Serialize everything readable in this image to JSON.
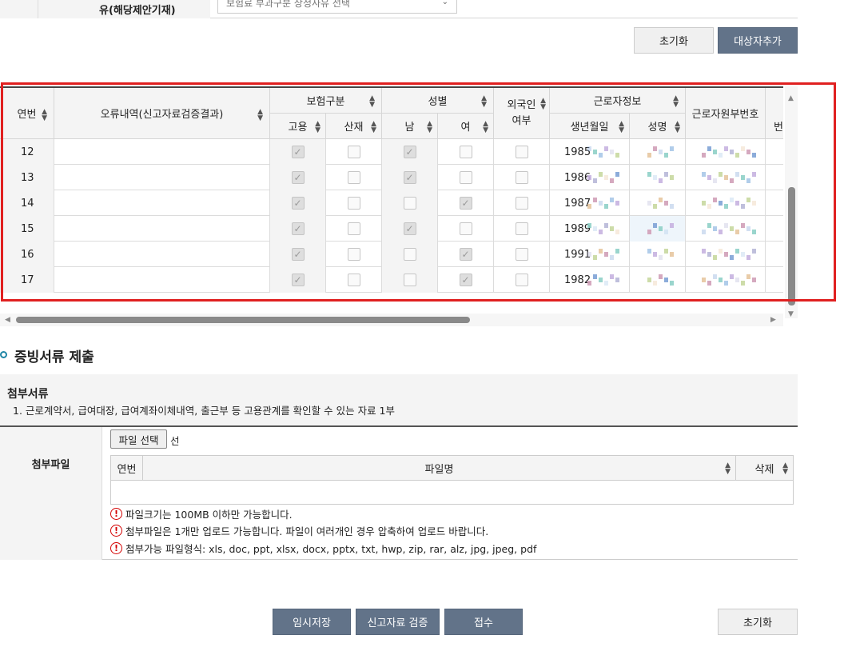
{
  "top": {
    "label": "유(해당제안기재)",
    "select_value": "보험료 부과구분 상정사유 선택"
  },
  "buttons": {
    "reset": "초기화",
    "add_target": "대상자추가",
    "temp_save": "임시저장",
    "verify": "신고자료 검증",
    "submit": "접수",
    "reset_bottom": "초기화",
    "file_select": "파일 선택",
    "file_none": "선"
  },
  "grid": {
    "headers": {
      "seq": "연번",
      "error": "오류내역(신고자료검증결과)",
      "insurance": "보험구분",
      "employment": "고용",
      "industrial": "산재",
      "gender": "성별",
      "male": "남",
      "female": "여",
      "foreign": "외국인",
      "foreign_2": "여부",
      "worker_info": "근로자정보",
      "birth": "생년월일",
      "name": "성명",
      "worker_no": "근로자원부번호",
      "extra": "번"
    },
    "rows": [
      {
        "seq": "12",
        "birth": "1985",
        "employment": true,
        "industrial": false,
        "male": true,
        "female": false,
        "foreign": false
      },
      {
        "seq": "13",
        "birth": "1986",
        "employment": true,
        "industrial": false,
        "male": true,
        "female": false,
        "foreign": false
      },
      {
        "seq": "14",
        "birth": "1987",
        "employment": true,
        "industrial": false,
        "male": false,
        "female": true,
        "foreign": false
      },
      {
        "seq": "15",
        "birth": "1989",
        "employment": true,
        "industrial": false,
        "male": true,
        "female": false,
        "foreign": false
      },
      {
        "seq": "16",
        "birth": "1991",
        "employment": true,
        "industrial": false,
        "male": false,
        "female": true,
        "foreign": false
      },
      {
        "seq": "17",
        "birth": "1982",
        "employment": true,
        "industrial": false,
        "male": false,
        "female": true,
        "foreign": false
      }
    ]
  },
  "section": {
    "title": "증빙서류 제출",
    "attach_title": "첨부서류",
    "attach_desc": "1. 근로계약서, 급여대장, 급여계좌이체내역, 출근부 등 고용관계를 확인할 수 있는 자료 1부",
    "attach_label": "첨부파일",
    "file_headers": {
      "seq": "연번",
      "filename": "파일명",
      "delete": "삭제"
    },
    "notes": [
      "파일크기는 100MB 이하만 가능합니다.",
      "첨부파일은 1개만 업로드 가능합니다. 파일이 여러개인 경우 압축하여 업로드 바랍니다.",
      "첨부가능 파일형식: xls, doc, ppt, xlsx, docx, pptx, txt, hwp, zip, rar, alz, jpg, jpeg, pdf"
    ]
  },
  "colors": {
    "accent": "#627389",
    "highlight": "#e02020",
    "warning": "#d40000"
  }
}
